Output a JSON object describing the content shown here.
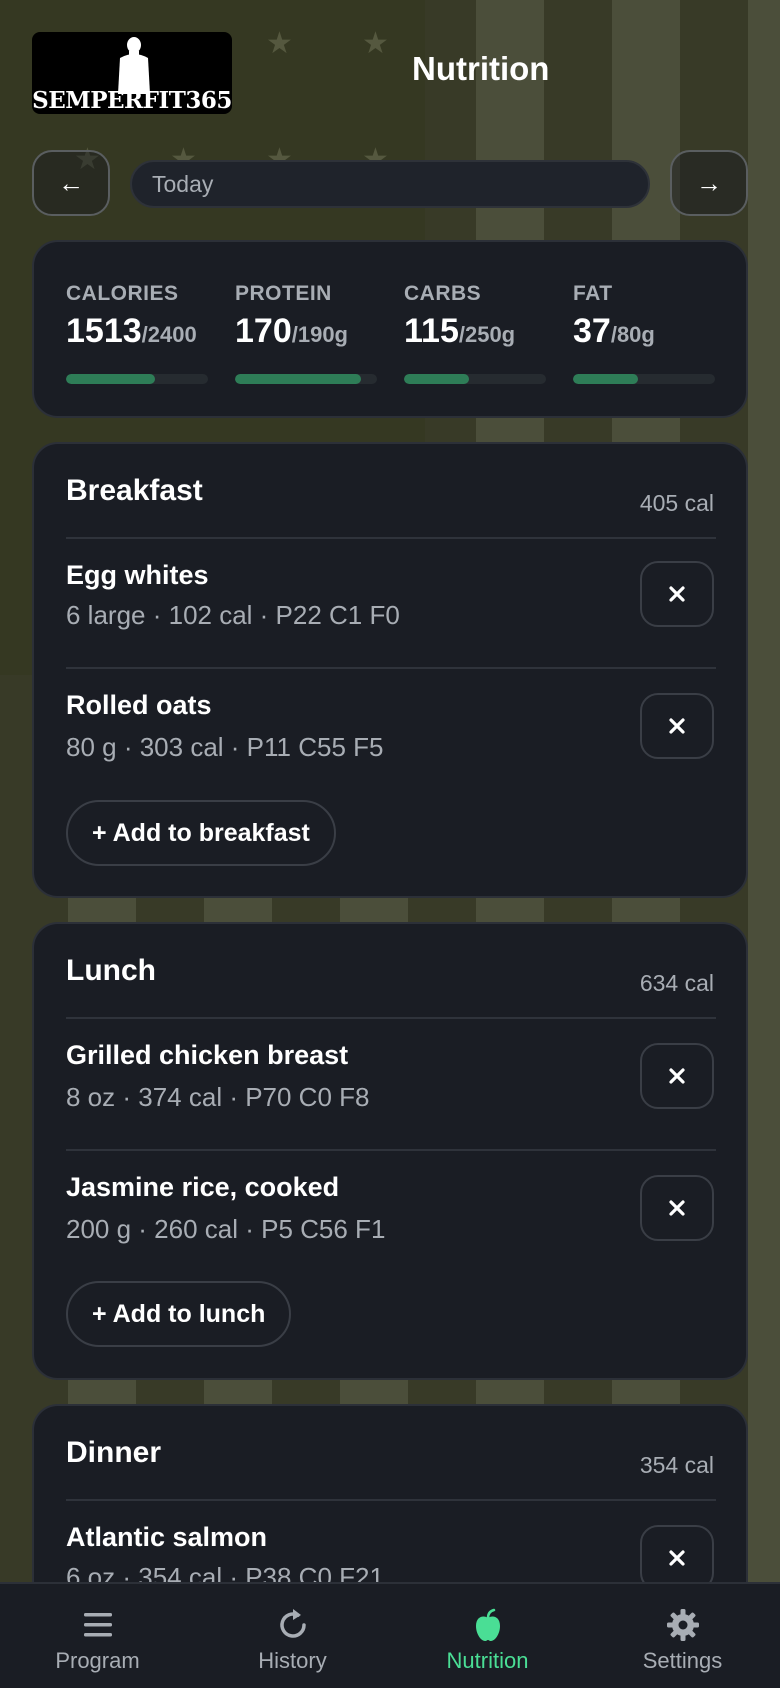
{
  "header": {
    "logo_text": "SEMPERFIT365",
    "title": "Nutrition"
  },
  "date_nav": {
    "prev_label": "←",
    "next_label": "→",
    "date_value": "Today"
  },
  "summary": [
    {
      "label": "CALORIES",
      "value": "1513",
      "goal": "/2400",
      "progress": 0.63
    },
    {
      "label": "PROTEIN",
      "value": "170",
      "goal": "/190g",
      "progress": 0.89
    },
    {
      "label": "CARBS",
      "value": "115",
      "goal": "/250g",
      "progress": 0.46
    },
    {
      "label": "FAT",
      "value": "37",
      "goal": "/80g",
      "progress": 0.46
    }
  ],
  "meals": {
    "breakfast": {
      "title": "Breakfast",
      "calories": "405 cal",
      "add_label": "+ Add to breakfast",
      "items": [
        {
          "name": "Egg whites",
          "meta": "6 large · 102 cal · P22 C1 F0"
        },
        {
          "name": "Rolled oats",
          "meta": "80 g · 303 cal · P11 C55 F5"
        }
      ]
    },
    "lunch": {
      "title": "Lunch",
      "calories": "634 cal",
      "add_label": "+ Add to lunch",
      "items": [
        {
          "name": "Grilled chicken breast",
          "meta": "8 oz · 374 cal · P70 C0 F8"
        },
        {
          "name": "Jasmine rice, cooked",
          "meta": "200 g · 260 cal · P5 C56 F1"
        }
      ]
    },
    "dinner": {
      "title": "Dinner",
      "calories": "354 cal",
      "items": [
        {
          "name": "Atlantic salmon",
          "meta": "6 oz · 354 cal · P38 C0 F21"
        }
      ]
    }
  },
  "tabs": [
    {
      "label": "Program",
      "icon": "menu-icon"
    },
    {
      "label": "History",
      "icon": "history-icon"
    },
    {
      "label": "Nutrition",
      "icon": "apple-icon",
      "active": true
    },
    {
      "label": "Settings",
      "icon": "gear-icon"
    }
  ],
  "colors": {
    "accent": "#4ade95",
    "progress": "#2e7d57",
    "card_bg": "#1a1d24"
  }
}
